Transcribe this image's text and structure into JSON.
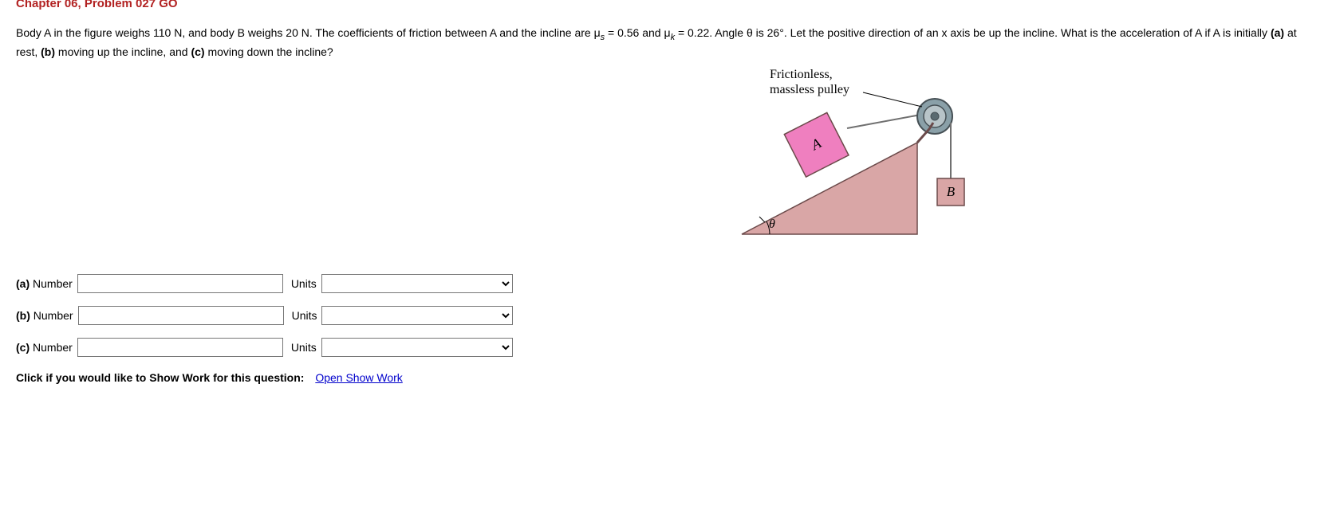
{
  "header": {
    "chapter_line": "Chapter 06, Problem 027 GO"
  },
  "problem": {
    "text_before_mus": "Body A in the figure weighs 110 N, and body B weighs 20 N. The coefficients of friction between A and the incline are μ",
    "mus_sub": "s",
    "text_mus_val": " = 0.56 and μ",
    "muk_sub": "k",
    "text_after_muk": " = 0.22. Angle θ is 26°. Let the positive direction of an x axis be up the incline. What is the acceleration of A if A is initially ",
    "part_a_b": "(a)",
    "part_a_t": " at rest, ",
    "part_b_b": "(b)",
    "part_b_t": " moving up the incline, and ",
    "part_c_b": "(c)",
    "part_c_t": " moving down the incline?"
  },
  "figure": {
    "pulley_label_line1": "Frictionless,",
    "pulley_label_line2": "massless pulley",
    "block_a": "A",
    "block_b": "B",
    "angle": "θ"
  },
  "answers": {
    "rows": [
      {
        "part": "(a)",
        "word": "Number",
        "units_label": "Units"
      },
      {
        "part": "(b)",
        "word": "Number",
        "units_label": "Units"
      },
      {
        "part": "(c)",
        "word": "Number",
        "units_label": "Units"
      }
    ]
  },
  "show_work": {
    "prompt": "Click if you would like to Show Work for this question:",
    "link": "Open Show Work"
  }
}
